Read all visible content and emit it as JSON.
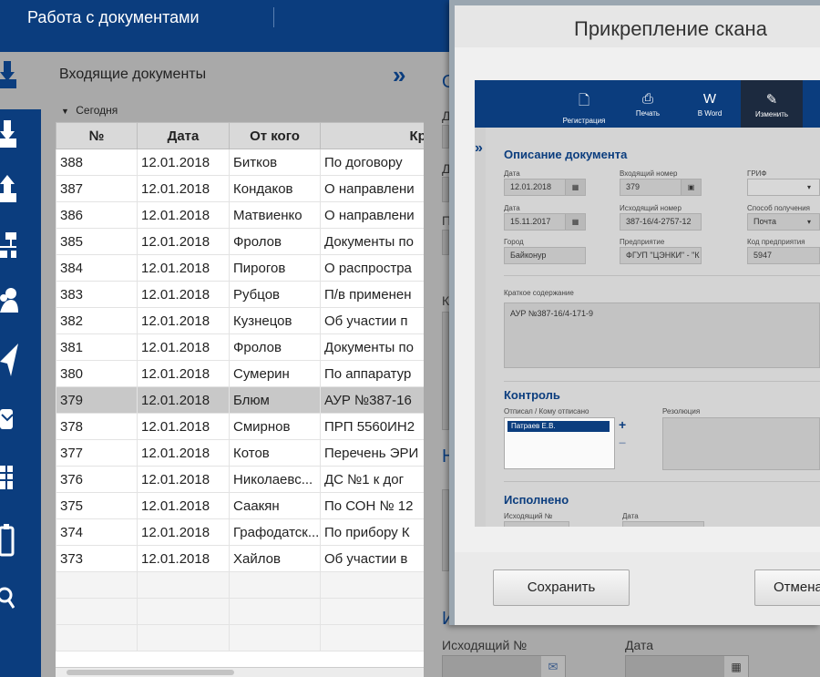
{
  "header": {
    "title": "Работа с документами"
  },
  "rail": {
    "icons": [
      "incoming-docs-icon",
      "download-icon",
      "upload-icon",
      "org-structure-icon",
      "users-icon",
      "send-icon",
      "mail-icon",
      "table-icon",
      "clipboard-icon",
      "search-icon"
    ]
  },
  "list": {
    "caption": "Входящие документы",
    "expand_glyph": "»",
    "group_label": "Сегодня",
    "columns": [
      "№",
      "Дата",
      "От кого",
      "Крат"
    ],
    "rows": [
      [
        "388",
        "12.01.2018",
        "Битков",
        "По договору"
      ],
      [
        "387",
        "12.01.2018",
        "Кондаков",
        "О направлени"
      ],
      [
        "386",
        "12.01.2018",
        "Матвиенко",
        "О направлени"
      ],
      [
        "385",
        "12.01.2018",
        "Фролов",
        "Документы по"
      ],
      [
        "384",
        "12.01.2018",
        "Пирогов",
        "О распростра"
      ],
      [
        "383",
        "12.01.2018",
        "Рубцов",
        "П/в применен"
      ],
      [
        "382",
        "12.01.2018",
        "Кузнецов",
        "Об участии п"
      ],
      [
        "381",
        "12.01.2018",
        "Фролов",
        "Документы по"
      ],
      [
        "380",
        "12.01.2018",
        "Сумерин",
        "По аппаратур"
      ],
      [
        "379",
        "12.01.2018",
        "Блюм",
        "АУР №387-16"
      ],
      [
        "378",
        "12.01.2018",
        "Смирнов",
        "ПРП 5560ИН2"
      ],
      [
        "377",
        "12.01.2018",
        "Котов",
        "Перечень ЭРИ"
      ],
      [
        "376",
        "12.01.2018",
        "Николаевс...",
        "ДС №1 к дог"
      ],
      [
        "375",
        "12.01.2018",
        "Саакян",
        "По СОН № 12"
      ],
      [
        "374",
        "12.01.2018",
        "Графодатск...",
        "По прибору К"
      ],
      [
        "373",
        "12.01.2018",
        "Хайлов",
        "Об участии в"
      ]
    ],
    "selected_row": "379"
  },
  "bgform": {
    "outgoing_label": "Исходящий №",
    "date_label": "Дата",
    "stub_o": "О",
    "stub_d1": "Д",
    "stub_d2": "Д",
    "stub_p": "П",
    "stub_k": "К",
    "stub_n": "Н",
    "stub_i": "И"
  },
  "modal": {
    "title": "Прикрепление скана",
    "save_label": "Сохранить",
    "cancel_label": "Отмена"
  },
  "scan": {
    "toolbar": [
      {
        "icon": "page-icon",
        "glyph": "🗋",
        "label": "Регистрация"
      },
      {
        "icon": "print-icon",
        "glyph": "⎙",
        "label": "Печать"
      },
      {
        "icon": "word-icon",
        "glyph": "W",
        "label": "В Word"
      },
      {
        "icon": "pencil-icon",
        "glyph": "✎",
        "label": "Изменить"
      }
    ],
    "section_desc": "Описание документа",
    "f_date_label": "Дата",
    "f_date": "12.01.2018",
    "f_in_label": "Входящий номер",
    "f_in": "379",
    "f_grif_label": "ГРИФ",
    "f_date2_label": "Дата",
    "f_date2": "15.11.2017",
    "f_out_label": "Исходящий номер",
    "f_out": "387-16/4-2757-12",
    "f_method_label": "Способ получения",
    "f_method": "Почта",
    "f_city_label": "Город",
    "f_city": "Байконур",
    "f_org_label": "Предприятие",
    "f_org": "ФГУП \"ЦЭНКИ\" - \"К",
    "f_code_label": "Код предприятия",
    "f_code": "5947",
    "f_summary_label": "Краткое содержание",
    "f_summary": "АУР №387-16/4-171-9",
    "section_control": "Контроль",
    "f_assigned_label": "Отписал / Кому отписано",
    "f_assigned": "Патраев Е.В.",
    "f_resolution_label": "Резолюция",
    "section_done": "Исполнено",
    "f_done_out_label": "Исходящий №",
    "f_done_date_label": "Дата"
  }
}
